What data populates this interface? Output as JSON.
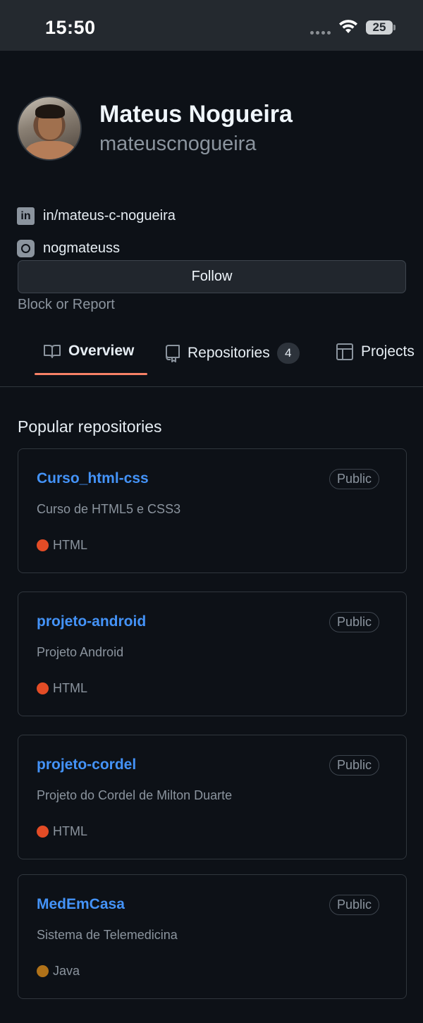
{
  "status_bar": {
    "time": "15:50",
    "battery": "25"
  },
  "profile": {
    "name": "Mateus Nogueira",
    "login": "mateuscnogueira",
    "linkedin": "in/mateus-c-nogueira",
    "instagram": "nogmateuss",
    "follow_label": "Follow",
    "block_label": "Block or Report"
  },
  "tabs": [
    {
      "label": "Overview",
      "icon": "book-icon",
      "active": true
    },
    {
      "label": "Repositories",
      "icon": "repo-icon",
      "count": "4"
    },
    {
      "label": "Projects",
      "icon": "table-icon"
    }
  ],
  "section_title": "Popular repositories",
  "repos": [
    {
      "name": "Curso_html-css",
      "visibility": "Public",
      "description": "Curso de HTML5 e CSS3",
      "language": "HTML",
      "language_color": "#e34c26"
    },
    {
      "name": "projeto-android",
      "visibility": "Public",
      "description": "Projeto Android",
      "language": "HTML",
      "language_color": "#e34c26"
    },
    {
      "name": "projeto-cordel",
      "visibility": "Public",
      "description": "Projeto do Cordel de Milton Duarte",
      "language": "HTML",
      "language_color": "#e34c26"
    },
    {
      "name": "MedEmCasa",
      "visibility": "Public",
      "description": "Sistema de Telemedicina",
      "language": "Java",
      "language_color": "#b07219"
    }
  ]
}
